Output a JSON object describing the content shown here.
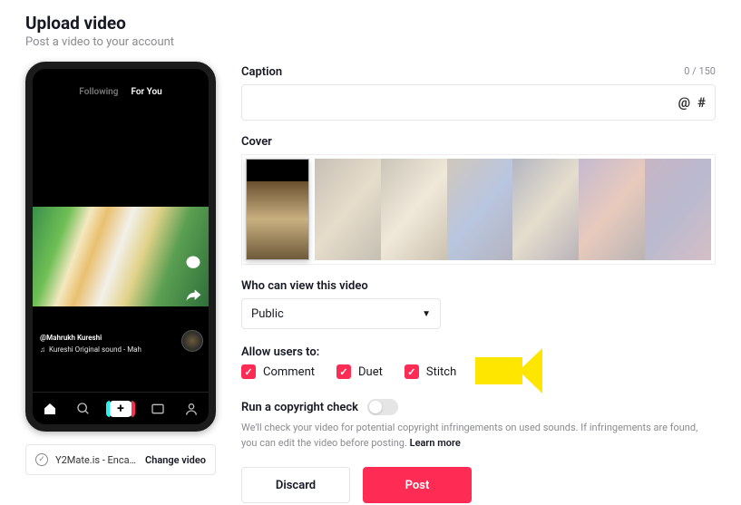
{
  "header": {
    "title": "Upload video",
    "subtitle": "Post a video to your account"
  },
  "phone": {
    "tabs": {
      "following": "Following",
      "foryou": "For You"
    },
    "username": "@Mahrukh Kureshi",
    "sound": "Kureshi Original sound - Mah"
  },
  "filebar": {
    "filename": "Y2Mate.is - Encanto bu...",
    "change": "Change video"
  },
  "caption": {
    "label": "Caption",
    "counter": "0 / 150",
    "value": "",
    "at": "@",
    "hash": "#"
  },
  "cover": {
    "label": "Cover"
  },
  "viewers": {
    "label": "Who can view this video",
    "selected": "Public"
  },
  "allow": {
    "label": "Allow users to:",
    "options": [
      {
        "key": "comment",
        "label": "Comment",
        "checked": true
      },
      {
        "key": "duet",
        "label": "Duet",
        "checked": true
      },
      {
        "key": "stitch",
        "label": "Stitch",
        "checked": true
      }
    ]
  },
  "copyright": {
    "label": "Run a copyright check",
    "help": "We'll check your video for potential copyright infringements on used sounds. If infringements are found, you can edit the video before posting.",
    "learn": "Learn more"
  },
  "buttons": {
    "discard": "Discard",
    "post": "Post"
  }
}
